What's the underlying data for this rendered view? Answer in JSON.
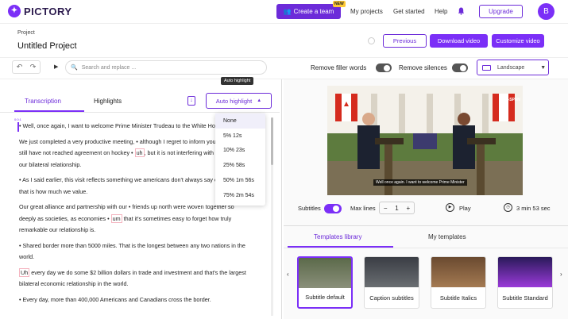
{
  "header": {
    "logo_text": "PICTORY",
    "create_team": "Create a team",
    "new_badge": "NEW",
    "nav": [
      "My projects",
      "Get started",
      "Help"
    ],
    "upgrade": "Upgrade",
    "avatar_letter": "B"
  },
  "project": {
    "label": "Project",
    "title": "Untitled Project",
    "previous": "Previous",
    "download": "Download video",
    "customize": "Customize video"
  },
  "toolbar": {
    "search_placeholder": "Search and replace ...",
    "remove_filler": "Remove filler words",
    "remove_silences": "Remove silences",
    "aspect": "Landscape"
  },
  "left": {
    "tab_transcription": "Transcription",
    "tab_highlights": "Highlights",
    "auto_highlight_tooltip": "Auto highlight",
    "auto_highlight_button": "Auto highlight",
    "timestamp_mark": "0:0:1",
    "transcript": [
      [
        "• Well, once again, I want to welcome Prime Minister Trudeau to the White House."
      ],
      [
        "We just completed a very productive meeting, • although I regret to inform you that we",
        "still have not reached agreement on hockey • ",
        "uh",
        ", but it is not interfering with",
        "our bilateral relationship."
      ],
      [
        "• As I said earlier, this visit reflects something we americans don't always say enough,",
        "that is how much we value."
      ],
      [
        "Our great alliance and partnership with our • friends up north were woven together so",
        "deeply as societies, as economies • ",
        "um",
        " that it's sometimes easy to forget how truly",
        "remarkable our relationship is."
      ],
      [
        "• Shared border more than 5000 miles. That is the longest between any two nations in the",
        "world."
      ],
      [
        "Uh",
        " every day we do some $2 billion dollars in trade and investment and that's the largest",
        "bilateral economic relationship in the world."
      ],
      [
        "• Every day, more than 400,000 Americans and Canadians cross the border."
      ]
    ],
    "dropdown": [
      "None",
      "5%   12s",
      "10%   23s",
      "25%   58s",
      "50%   1m 56s",
      "75%   2m 54s"
    ]
  },
  "video": {
    "caption": "Well once again. I want to welcome Prime Minister",
    "logo": "C-SPAN"
  },
  "controls": {
    "subtitles": "Subtitles",
    "max_lines": "Max lines",
    "minus": "−",
    "lines_value": "1",
    "plus": "+",
    "play": "Play",
    "duration": "3 min 53 sec"
  },
  "templates": {
    "tab_library": "Templates library",
    "tab_mine": "My templates",
    "items": [
      {
        "label": "Subtitle default"
      },
      {
        "label": "Caption subtitles"
      },
      {
        "label": "Subtitle Italics"
      },
      {
        "label": "Subtitle Standard"
      }
    ]
  },
  "colors": {
    "accent": "#7b2ff7",
    "accent_dark": "#6c2bd9"
  }
}
